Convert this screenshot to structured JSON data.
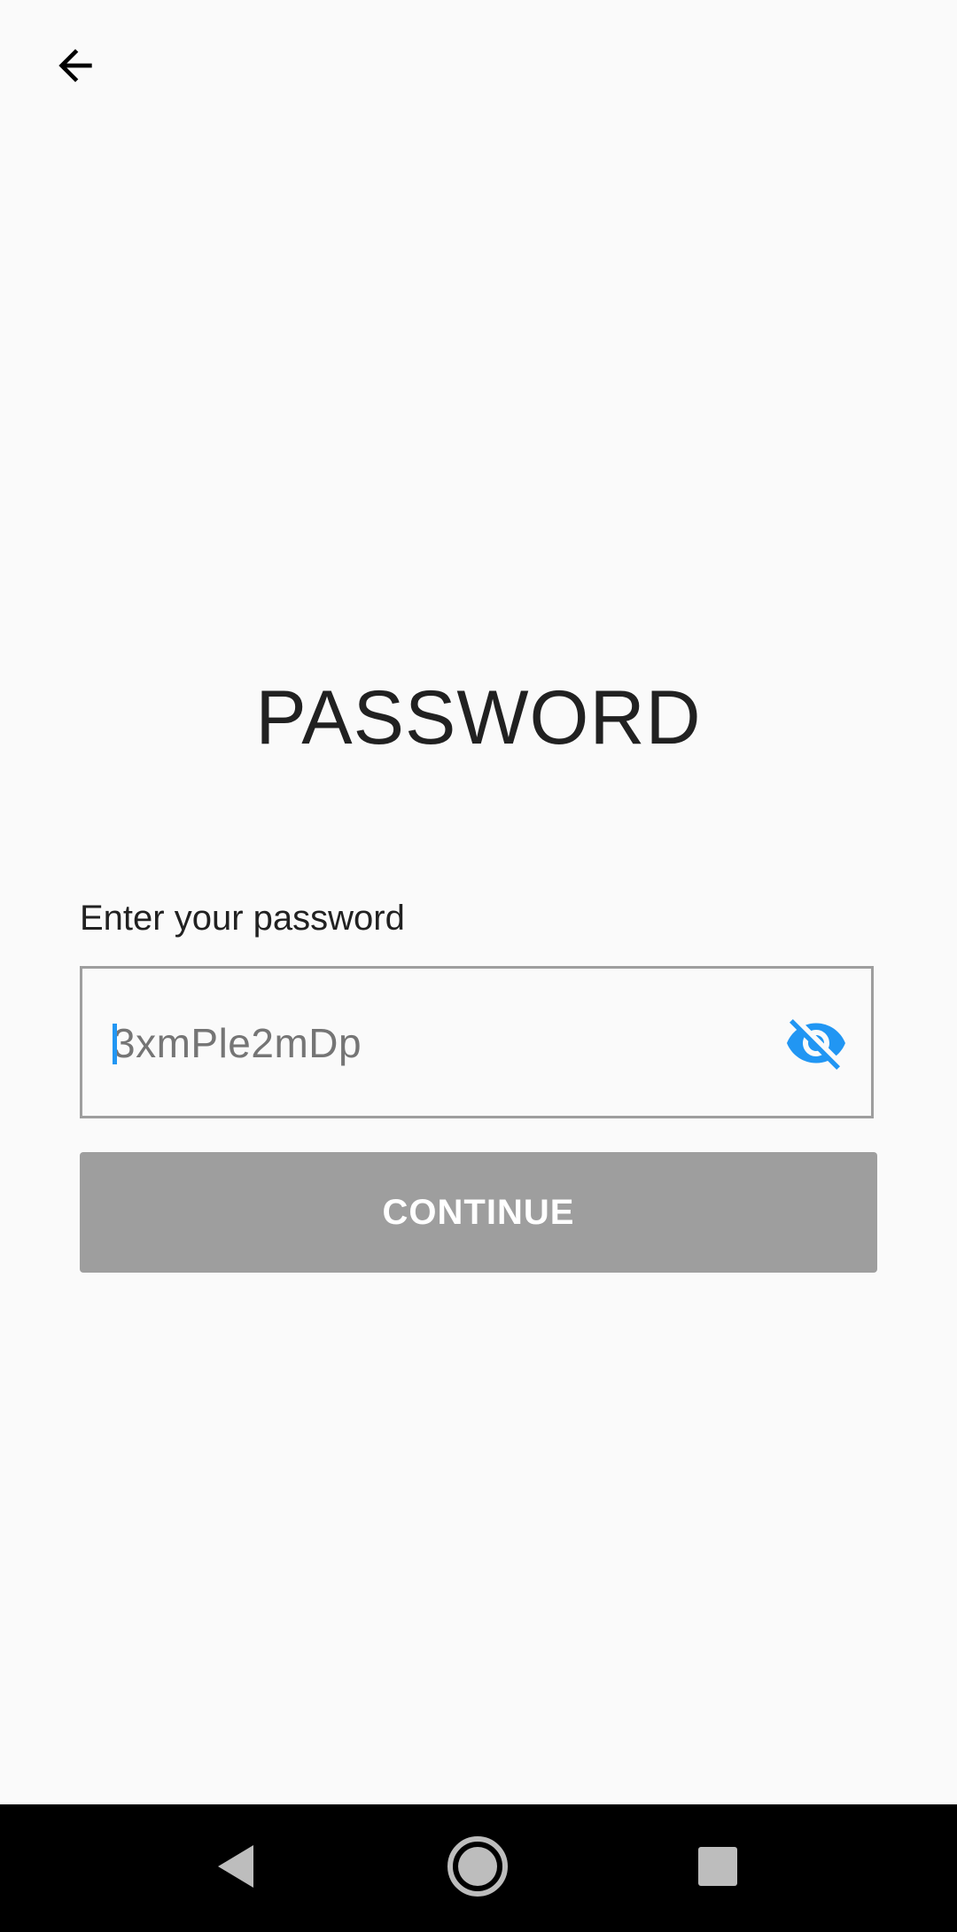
{
  "header": {
    "back_icon": "arrow-left-icon"
  },
  "main": {
    "title": "PASSWORD",
    "field_label": "Enter your password",
    "password_value": "3xmPle2mDp",
    "toggle_icon": "eye-off-icon",
    "continue_label": "CONTINUE"
  },
  "navigation_bar": {
    "back_icon": "nav-back-icon",
    "home_icon": "nav-home-icon",
    "recents_icon": "nav-recents-icon"
  },
  "colors": {
    "background": "#fafafa",
    "accent": "#2196f3",
    "button_disabled": "#9e9e9e",
    "text_primary": "#212121",
    "nav_bar": "#000000"
  }
}
